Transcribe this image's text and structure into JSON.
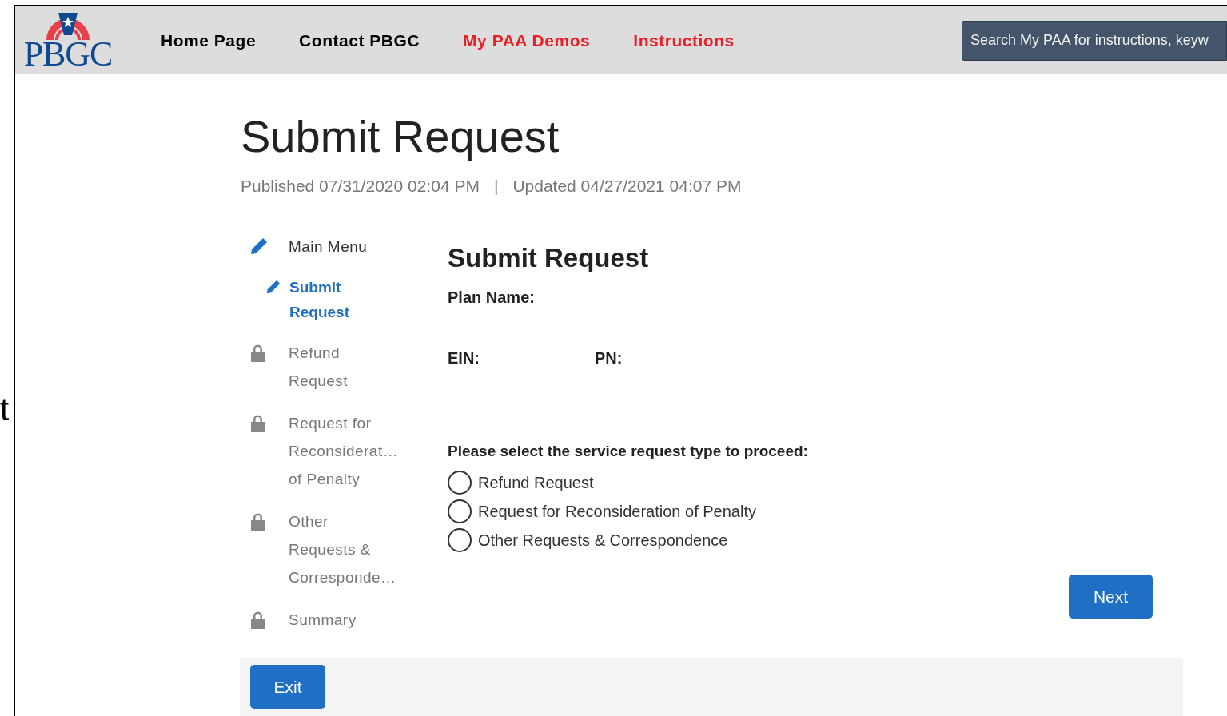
{
  "background_fragment": "t",
  "header": {
    "logo": "PBGC",
    "nav": [
      {
        "label": "Home Page",
        "highlight": false
      },
      {
        "label": "Contact PBGC",
        "highlight": false
      },
      {
        "label": "My PAA Demos",
        "highlight": true
      },
      {
        "label": "Instructions",
        "highlight": true
      }
    ],
    "search": {
      "placeholder": "Search My PAA for instructions, keyw"
    }
  },
  "page": {
    "title": "Submit Request",
    "published": "Published 07/31/2020 02:04 PM",
    "separator": "|",
    "updated": "Updated 04/27/2021 04:07 PM"
  },
  "steps": [
    {
      "label": "Main Menu",
      "locked": false,
      "selected": false,
      "children": [
        {
          "label": "Submit Request",
          "locked": false,
          "selected": true
        }
      ]
    },
    {
      "label": "Refund Request",
      "locked": true,
      "selected": false
    },
    {
      "label": "Request for Reconsiderat… of Penalty",
      "locked": true,
      "selected": false
    },
    {
      "label": "Other Requests & Corresponde…",
      "locked": true,
      "selected": false
    },
    {
      "label": "Summary",
      "locked": true,
      "selected": false
    }
  ],
  "form": {
    "title": "Submit Request",
    "fields": [
      {
        "label": "Plan Name:"
      },
      {
        "label": "EIN:"
      },
      {
        "label": "PN:"
      }
    ],
    "prompt": "Please select the service request type to proceed:",
    "options": [
      {
        "label": "Refund Request",
        "selected": false
      },
      {
        "label": "Request for Reconsideration of Penalty",
        "selected": false
      },
      {
        "label": "Other Requests & Correspondence",
        "selected": false
      }
    ]
  },
  "buttons": {
    "next": "Next",
    "exit": "Exit"
  }
}
